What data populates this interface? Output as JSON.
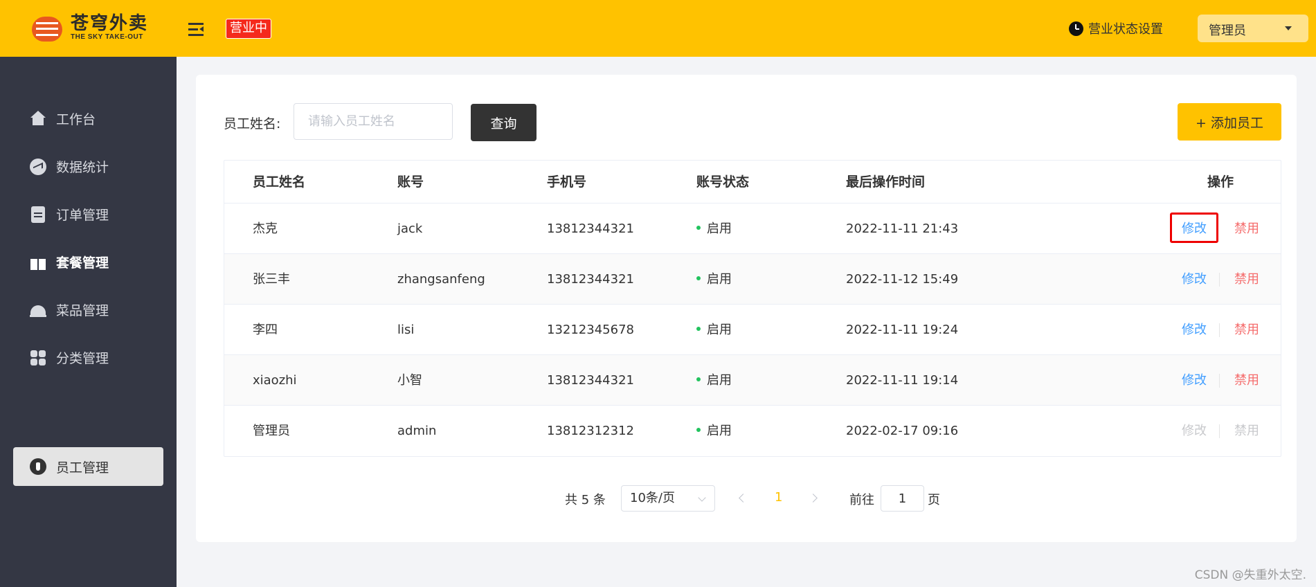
{
  "header": {
    "logo_cn": "苍穹外卖",
    "logo_en": "THE SKY TAKE-OUT",
    "status_badge": "营业中",
    "biz_setting": "营业状态设置",
    "user_name": "管理员",
    "colors": {
      "header_bg": "#ffc200",
      "badge_bg": "#f52a1c"
    }
  },
  "sidebar": {
    "items": [
      {
        "label": "工作台",
        "icon": "home-icon"
      },
      {
        "label": "数据统计",
        "icon": "chart-icon"
      },
      {
        "label": "订单管理",
        "icon": "clipboard-icon"
      },
      {
        "label": "套餐管理",
        "icon": "gift-icon"
      },
      {
        "label": "菜品管理",
        "icon": "dish-cover-icon"
      },
      {
        "label": "分类管理",
        "icon": "grid-icon"
      },
      {
        "label": "员工管理",
        "icon": "employee-tie-icon",
        "active": true
      }
    ]
  },
  "search": {
    "label": "员工姓名:",
    "placeholder": "请输入员工姓名",
    "value": "",
    "query_button": "查询",
    "add_button": "+ 添加员工"
  },
  "table": {
    "headers": [
      "员工姓名",
      "账号",
      "手机号",
      "账号状态",
      "最后操作时间",
      "操作"
    ],
    "rows": [
      {
        "name": "杰克",
        "account": "jack",
        "phone": "13812344321",
        "status": "启用",
        "time": "2022-11-11 21:43",
        "edit": "修改",
        "disable": "禁用"
      },
      {
        "name": "张三丰",
        "account": "zhangsanfeng",
        "phone": "13812344321",
        "status": "启用",
        "time": "2022-11-12 15:49",
        "edit": "修改",
        "disable": "禁用"
      },
      {
        "name": "李四",
        "account": "lisi",
        "phone": "13212345678",
        "status": "启用",
        "time": "2022-11-11 19:24",
        "edit": "修改",
        "disable": "禁用"
      },
      {
        "name": "xiaozhi",
        "account": "小智",
        "phone": "13812344321",
        "status": "启用",
        "time": "2022-11-11 19:14",
        "edit": "修改",
        "disable": "禁用"
      },
      {
        "name": "管理员",
        "account": "admin",
        "phone": "13812312312",
        "status": "启用",
        "time": "2022-02-17 09:16",
        "edit": "修改",
        "disable": "禁用"
      }
    ]
  },
  "pagination": {
    "total": "共 5 条",
    "page_size": "10条/页",
    "current_page": "1",
    "goto_label": "前往",
    "goto_value": "1",
    "page_suffix": "页"
  },
  "watermark": "CSDN @失重外太空."
}
